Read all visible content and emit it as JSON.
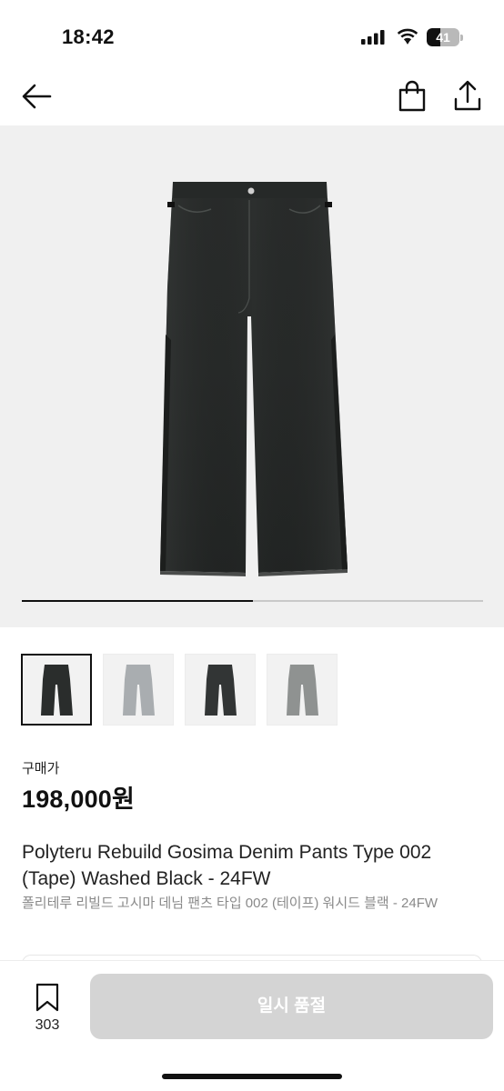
{
  "status_bar": {
    "time": "18:42",
    "battery_level": "41",
    "icons": [
      "signal-icon",
      "wifi-icon",
      "battery-icon"
    ]
  },
  "nav": {
    "icons": [
      "back-arrow-icon",
      "shopping-bag-icon",
      "share-icon"
    ]
  },
  "gallery": {
    "progress": 0.5,
    "thumbnails": [
      {
        "variant": "washed-black",
        "selected": true
      },
      {
        "variant": "light-grey",
        "selected": false
      },
      {
        "variant": "washed-black",
        "selected": false
      },
      {
        "variant": "grey",
        "selected": false
      }
    ]
  },
  "product": {
    "price_label": "구매가",
    "price": "198,000원",
    "title_en": "Polyteru Rebuild Gosima Denim Pants Type 002 (Tape) Washed Black - 24FW",
    "title_ko": "폴리테루 리빌드 고시마 데님 팬츠 타입 002 (테이프) 워시드 블랙 - 24FW"
  },
  "bottom_bar": {
    "wish_count": "303",
    "cta_label": "일시 품절"
  },
  "colors": {
    "text": "#111111",
    "muted": "#8a8a8a",
    "cta_disabled": "#d4d4d4",
    "image_bg": "#f0f0f0"
  }
}
